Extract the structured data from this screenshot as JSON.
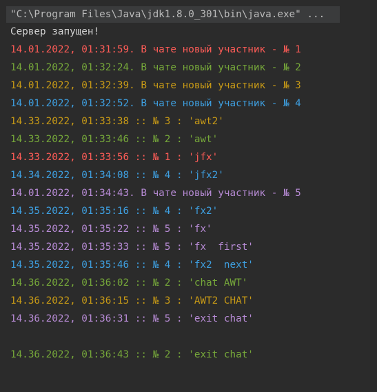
{
  "console": {
    "command": "\"C:\\Program Files\\Java\\jdk1.8.0_301\\bin\\java.exe\" ...",
    "lines": [
      {
        "text": "Сервер запущен!",
        "color": "white"
      },
      {
        "text": "14.01.2022, 01:31:59. В чате новый участник - № 1",
        "color": "red"
      },
      {
        "text": "14.01.2022, 01:32:24. В чате новый участник - № 2",
        "color": "green"
      },
      {
        "text": "14.01.2022, 01:32:39. В чате новый участник - № 3",
        "color": "yellow"
      },
      {
        "text": "14.01.2022, 01:32:52. В чате новый участник - № 4",
        "color": "blue"
      },
      {
        "text": "14.33.2022, 01:33:38 :: № 3 : 'awt2'",
        "color": "yellow"
      },
      {
        "text": "14.33.2022, 01:33:46 :: № 2 : 'awt'",
        "color": "green"
      },
      {
        "text": "14.33.2022, 01:33:56 :: № 1 : 'jfx'",
        "color": "red"
      },
      {
        "text": "14.34.2022, 01:34:08 :: № 4 : 'jfx2'",
        "color": "blue"
      },
      {
        "text": "14.01.2022, 01:34:43. В чате новый участник - № 5",
        "color": "purple"
      },
      {
        "text": "14.35.2022, 01:35:16 :: № 4 : 'fx2'",
        "color": "blue"
      },
      {
        "text": "14.35.2022, 01:35:22 :: № 5 : 'fx'",
        "color": "purple"
      },
      {
        "text": "14.35.2022, 01:35:33 :: № 5 : 'fx  first'",
        "color": "purple"
      },
      {
        "text": "14.35.2022, 01:35:46 :: № 4 : 'fx2  next'",
        "color": "blue"
      },
      {
        "text": "14.36.2022, 01:36:02 :: № 2 : 'chat AWT'",
        "color": "green"
      },
      {
        "text": "14.36.2022, 01:36:15 :: № 3 : 'AWT2 CHAT'",
        "color": "yellow"
      },
      {
        "text": "14.36.2022, 01:36:31 :: № 5 : 'exit chat'",
        "color": "purple"
      },
      {
        "text": "",
        "color": "white"
      },
      {
        "text": "14.36.2022, 01:36:43 :: № 2 : 'exit chat'",
        "color": "green"
      }
    ]
  },
  "colors": {
    "background": "#2b2b2b",
    "command_bar": "#3a3b3c",
    "white": "#d4d4d4",
    "red": "#ff5c57",
    "green": "#76a83a",
    "yellow": "#c89a16",
    "blue": "#3e9fe0",
    "purple": "#b78bd5"
  }
}
